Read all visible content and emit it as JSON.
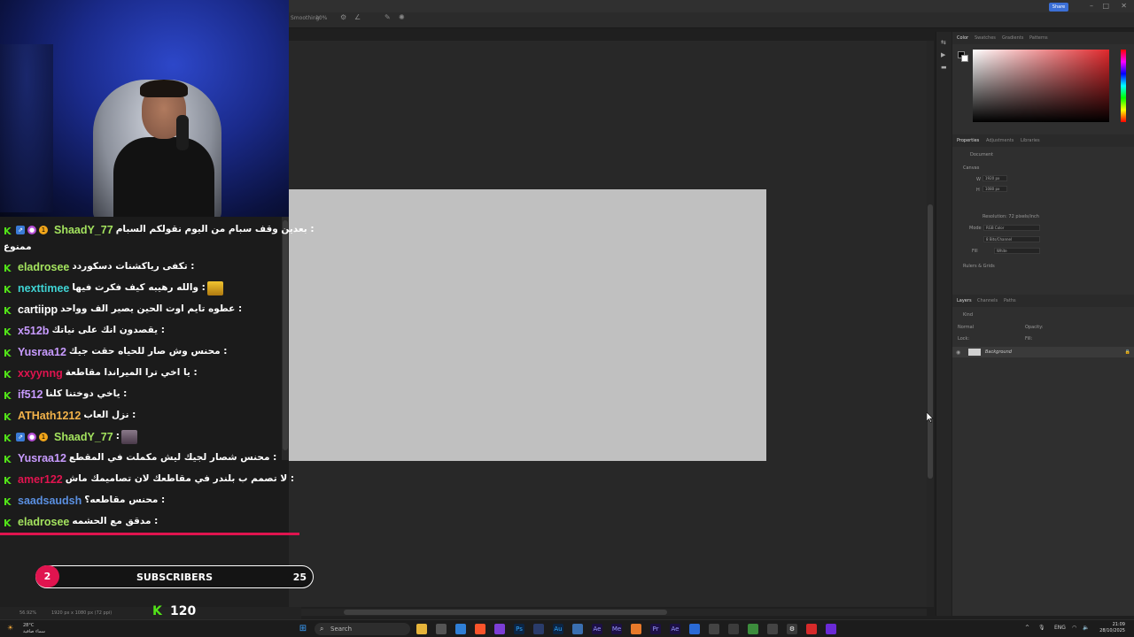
{
  "photoshop": {
    "options": {
      "smoothing_label": "Smoothing:",
      "smoothing_value": "10%"
    },
    "share_label": "Share",
    "status": {
      "zoom": "56.92%",
      "doc_size": "1920 px x 1080 px (72 ppi)"
    },
    "color_panel": {
      "tabs": [
        "Color",
        "Swatches",
        "Gradients",
        "Patterns"
      ]
    },
    "properties_panel": {
      "tabs": [
        "Properties",
        "Adjustments",
        "Libraries"
      ],
      "doc_label": "Document",
      "canvas_label": "Canvas",
      "width_label": "W",
      "width_value": "1920 px",
      "height_label": "H",
      "height_value": "1080 px",
      "resolution": "Resolution: 72 pixels/inch",
      "mode_label": "Mode",
      "mode_value": "RGB Color",
      "depth_value": "8 Bits/Channel",
      "fill_label": "Fill",
      "fill_value": "White",
      "rulers_label": "Rulers & Grids"
    },
    "layers_panel": {
      "tabs": [
        "Layers",
        "Channels",
        "Paths"
      ],
      "kind_placeholder": "Kind",
      "blend_mode": "Normal",
      "opacity_label": "Opacity:",
      "lock_label": "Lock:",
      "fill_label": "Fill:",
      "layer_name": "Background"
    }
  },
  "chat": {
    "messages": [
      {
        "nick": "ShaadY_77",
        "nick_color": "#a3e25e",
        "text": "بعدين وقف سبام من اليوم نقولكم السبام : ",
        "text_line2": "ممنوع",
        "badges": [
          "kick",
          "moderator",
          "og",
          "gift"
        ]
      },
      {
        "nick": "eladrosee",
        "nick_color": "#a3e25e",
        "text": "تكفى رياكشنات دسكوردد : "
      },
      {
        "nick": "nexttimee",
        "nick_color": "#3fd3d3",
        "text": "والله رهيبه كيف فكرت فيها : ",
        "emote": true
      },
      {
        "nick": "cartiipp",
        "nick_color": "#ffffff",
        "text": "عطوه تايم اوت الحين يصير الف وواحد : "
      },
      {
        "nick": "x512b",
        "nick_color": "#c89bff",
        "text": "يقصدون انك على نياتك : "
      },
      {
        "nick": "Yusraa12",
        "nick_color": "#c89bff",
        "text": "محنس وش صار للحياه حقت جيك : "
      },
      {
        "nick": "xxyynng",
        "nick_color": "#e0144f",
        "text": "يا اخي ترا الميراندا مقاطعة : "
      },
      {
        "nick": "if512",
        "nick_color": "#c89bff",
        "text": "ياخي دوختنا كلنا : "
      },
      {
        "nick": "ATHath1212",
        "nick_color": "#f2b24a",
        "text": "نزل العاب : "
      },
      {
        "nick": "ShaadY_77",
        "nick_color": "#a3e25e",
        "text": " : ",
        "emote": true,
        "badges": [
          "kick",
          "moderator",
          "og",
          "gift"
        ]
      },
      {
        "nick": "Yusraa12",
        "nick_color": "#c89bff",
        "text": "محنس شصار لجيك ليش مكملت في المقطع : "
      },
      {
        "nick": "amer122",
        "nick_color": "#e0144f",
        "text": "لا تصمم ب بلندر في مقاطعك لان تصاميمك ماش : "
      },
      {
        "nick": "saadsaudsh",
        "nick_color": "#5a8fe0",
        "text": "محنس مقاطعه؟ : "
      },
      {
        "nick": "eladrosee",
        "nick_color": "#a3e25e",
        "text": "مدقق مع الحشمه : "
      }
    ]
  },
  "overlay": {
    "subs_current": "2",
    "subs_label": "SUBSCRIBERS",
    "subs_goal": "25",
    "kick_followers": "120"
  },
  "taskbar": {
    "weather_temp": "28°C",
    "weather_desc": "سماء صافية",
    "search_label": "Search",
    "lang": "ENG",
    "time": "21:09",
    "date": "28/10/2025"
  },
  "colors": {
    "kick_green": "#52e318",
    "accent_pink": "#e0144f",
    "canvas_gray": "#c0c0c0"
  }
}
